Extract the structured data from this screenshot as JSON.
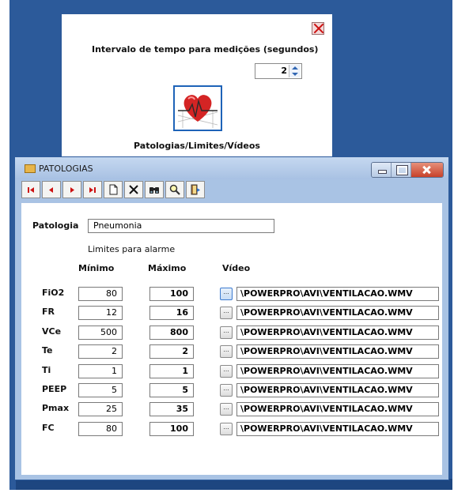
{
  "top_dialog": {
    "interval_label": "Intervalo de tempo para medições (segundos)",
    "interval_value": "2",
    "pathology_button_label": "Patologias/Limites/Vídeos"
  },
  "window": {
    "title": "PATOLOGIAS",
    "icons": [
      "folder-icon",
      "first-record-icon",
      "prev-record-icon",
      "next-record-icon",
      "last-record-icon",
      "new-record-icon",
      "delete-icon",
      "binoculars-icon",
      "magnifier-icon",
      "exit-door-icon"
    ]
  },
  "form": {
    "patologia_label": "Patologia",
    "patologia_value": "Pneumonia",
    "limits_title": "Limites para alarme",
    "col_min": "Mínimo",
    "col_max": "Máximo",
    "col_video": "Vídeo",
    "browse_label": "...",
    "rows": [
      {
        "param": "FiO2",
        "min": "80",
        "max": "100",
        "video": "\\POWERPRO\\AVI\\VENTILACAO.WMV"
      },
      {
        "param": "FR",
        "min": "12",
        "max": "16",
        "video": "\\POWERPRO\\AVI\\VENTILACAO.WMV"
      },
      {
        "param": "VCe",
        "min": "500",
        "max": "800",
        "video": "\\POWERPRO\\AVI\\VENTILACAO.WMV"
      },
      {
        "param": "Te",
        "min": "2",
        "max": "2",
        "video": "\\POWERPRO\\AVI\\VENTILACAO.WMV"
      },
      {
        "param": "Ti",
        "min": "1",
        "max": "1",
        "video": "\\POWERPRO\\AVI\\VENTILACAO.WMV"
      },
      {
        "param": "PEEP",
        "min": "5",
        "max": "5",
        "video": "\\POWERPRO\\AVI\\VENTILACAO.WMV"
      },
      {
        "param": "Pmax",
        "min": "25",
        "max": "35",
        "video": "\\POWERPRO\\AVI\\VENTILACAO.WMV"
      },
      {
        "param": "FC",
        "min": "80",
        "max": "100",
        "video": "\\POWERPRO\\AVI\\VENTILACAO.WMV"
      }
    ]
  },
  "colors": {
    "desktop": "#2c5a9a",
    "window_frame": "#a9c3e4",
    "heart": "#d42424"
  }
}
